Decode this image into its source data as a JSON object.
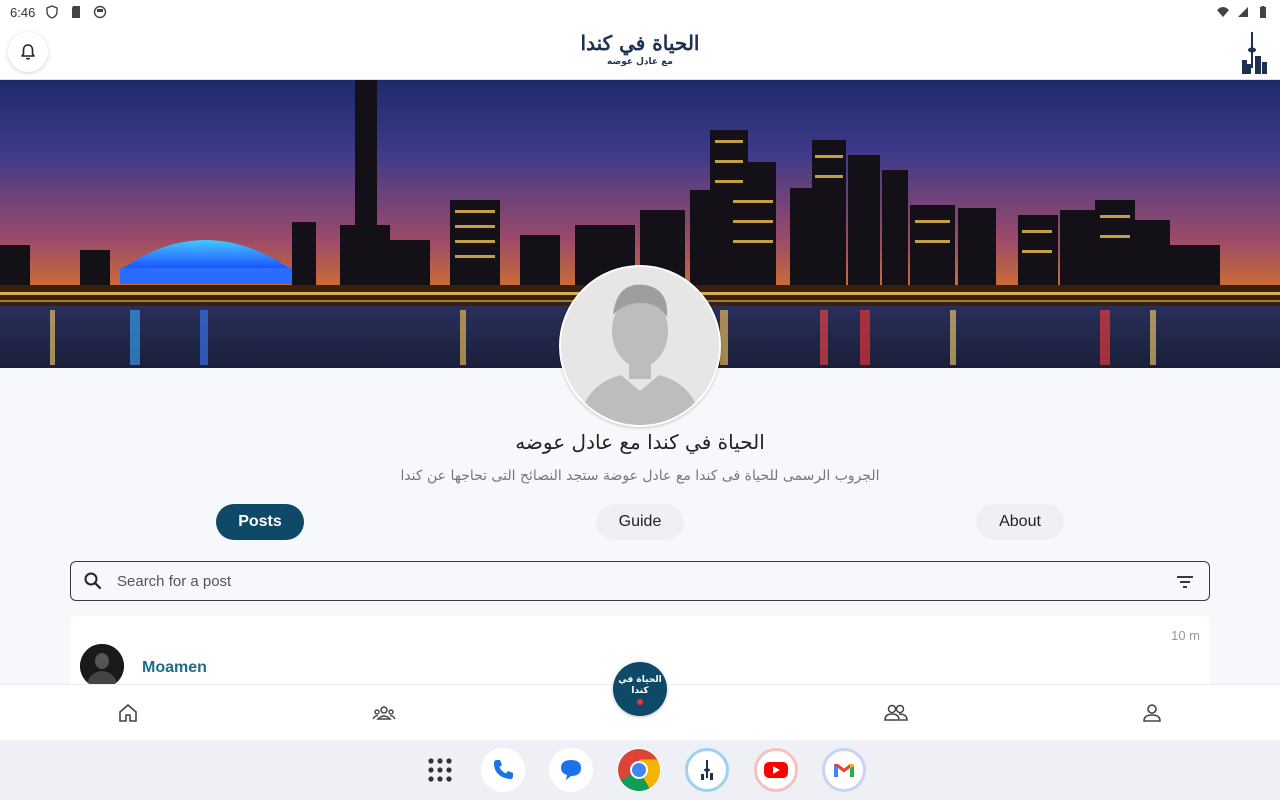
{
  "status_bar": {
    "time": "6:46",
    "left_icons": [
      "shield-icon",
      "sd-card-icon",
      "sync-icon"
    ],
    "right_icons": [
      "wifi-icon",
      "cellular-icon",
      "battery-icon"
    ]
  },
  "header": {
    "logo_title": "الحياة في كندا",
    "logo_subtitle": "مع عادل عوضه",
    "icons": [
      "bell-icon",
      "cn-tower-icon"
    ]
  },
  "profile": {
    "name": "الحياة في كندا مع عادل عوضه",
    "description": "الجروب الرسمى للحياة فى كندا مع عادل عوضة ستجد النصائح التى تحاجها عن كندا"
  },
  "tabs": [
    {
      "label": "Posts",
      "active": true
    },
    {
      "label": "Guide",
      "active": false
    },
    {
      "label": "About",
      "active": false
    }
  ],
  "search": {
    "placeholder": "Search for a post",
    "icons": [
      "search-icon",
      "filter-icon"
    ]
  },
  "post": {
    "author": "Moamen",
    "time": "10 m"
  },
  "bottom_nav": {
    "items": [
      "home-icon",
      "groups-icon",
      "people-icon",
      "account-icon"
    ],
    "center_logo_text_line1": "الحياة في",
    "center_logo_text_line2": "كندا"
  },
  "taskbar": {
    "apps": [
      "app-drawer-icon",
      "phone-icon",
      "messages-icon",
      "chrome-icon",
      "life-in-canada-app-icon",
      "youtube-icon",
      "gmail-icon"
    ]
  },
  "colors": {
    "accent": "#0e4a68",
    "author_link": "#1b6e86",
    "background": "#f7f8fb"
  }
}
